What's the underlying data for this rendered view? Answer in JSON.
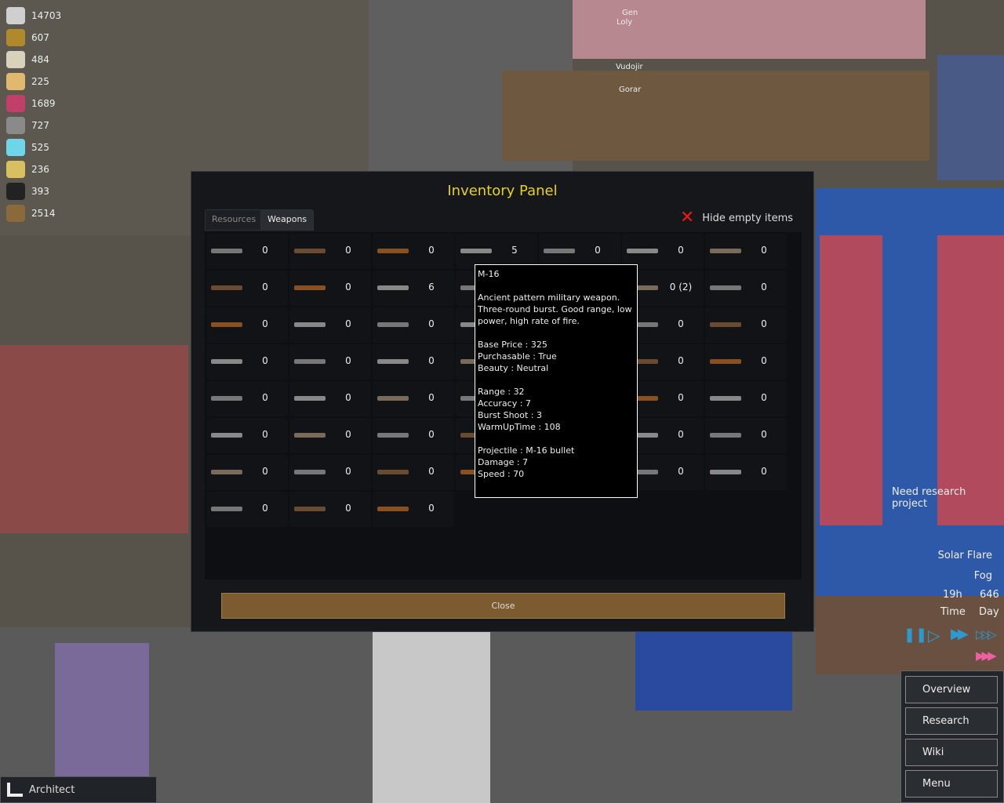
{
  "resources": [
    {
      "icon": "silver-icon",
      "value": "14703",
      "color": "#cfcfcf"
    },
    {
      "icon": "wood-icon",
      "value": "607",
      "color": "#b08a2a"
    },
    {
      "icon": "steel-icon",
      "value": "484",
      "color": "#d8d2bb"
    },
    {
      "icon": "food-icon",
      "value": "225",
      "color": "#e0b870"
    },
    {
      "icon": "meat-icon",
      "value": "1689",
      "color": "#c0406a"
    },
    {
      "icon": "stone-icon",
      "value": "727",
      "color": "#8a8a8a"
    },
    {
      "icon": "medicine-icon",
      "value": "525",
      "color": "#6fd6ea"
    },
    {
      "icon": "component-icon",
      "value": "236",
      "color": "#d8c060"
    },
    {
      "icon": "cloth-icon",
      "value": "393",
      "color": "#222"
    },
    {
      "icon": "leather-icon",
      "value": "2514",
      "color": "#8a6a3a"
    }
  ],
  "colonists": [
    "Gen",
    "Loly",
    "Vudojir",
    "Gorar"
  ],
  "panel": {
    "title": "Inventory Panel",
    "tabs": [
      {
        "label": "Resources",
        "active": false
      },
      {
        "label": "Weapons",
        "active": true
      }
    ],
    "hide_empty_label": "Hide empty items",
    "close_label": "Close",
    "rows": [
      [
        "0",
        "0",
        "0",
        "5",
        "0",
        "0",
        "0"
      ],
      [
        "0",
        "0",
        "6",
        "",
        "",
        "0 (2)",
        "0"
      ],
      [
        "0",
        "0",
        "0",
        "",
        "",
        "0",
        "0"
      ],
      [
        "0",
        "0",
        "0",
        "",
        "",
        "0",
        "0"
      ],
      [
        "0",
        "0",
        "0",
        "",
        "",
        "0",
        "0"
      ],
      [
        "0",
        "0",
        "0",
        "",
        "",
        "0",
        "0"
      ],
      [
        "0",
        "0",
        "0",
        "",
        "",
        "0",
        "0"
      ],
      [
        "0",
        "0",
        "0"
      ]
    ]
  },
  "tooltip": {
    "name": "M-16",
    "description": "Ancient pattern military weapon. Three-round burst. Good range, low power, high rate of fire.",
    "stats1": "Base Price : 325\nPurchasable : True\nBeauty : Neutral",
    "stats2": "Range : 32\nAccuracy : 7\nBurst Shoot : 3\nWarmUpTime : 108",
    "stats3": "Projectile : M-16 bullet\nDamage : 7\nSpeed : 70"
  },
  "status": {
    "research": "Need research project",
    "conditions": [
      "Solar Flare",
      "Fog"
    ],
    "hour": "19h",
    "day": "646",
    "time_label": "Time",
    "day_label": "Day"
  },
  "menu": [
    "Overview",
    "Research",
    "Wiki",
    "Menu"
  ],
  "architect_label": "Architect"
}
